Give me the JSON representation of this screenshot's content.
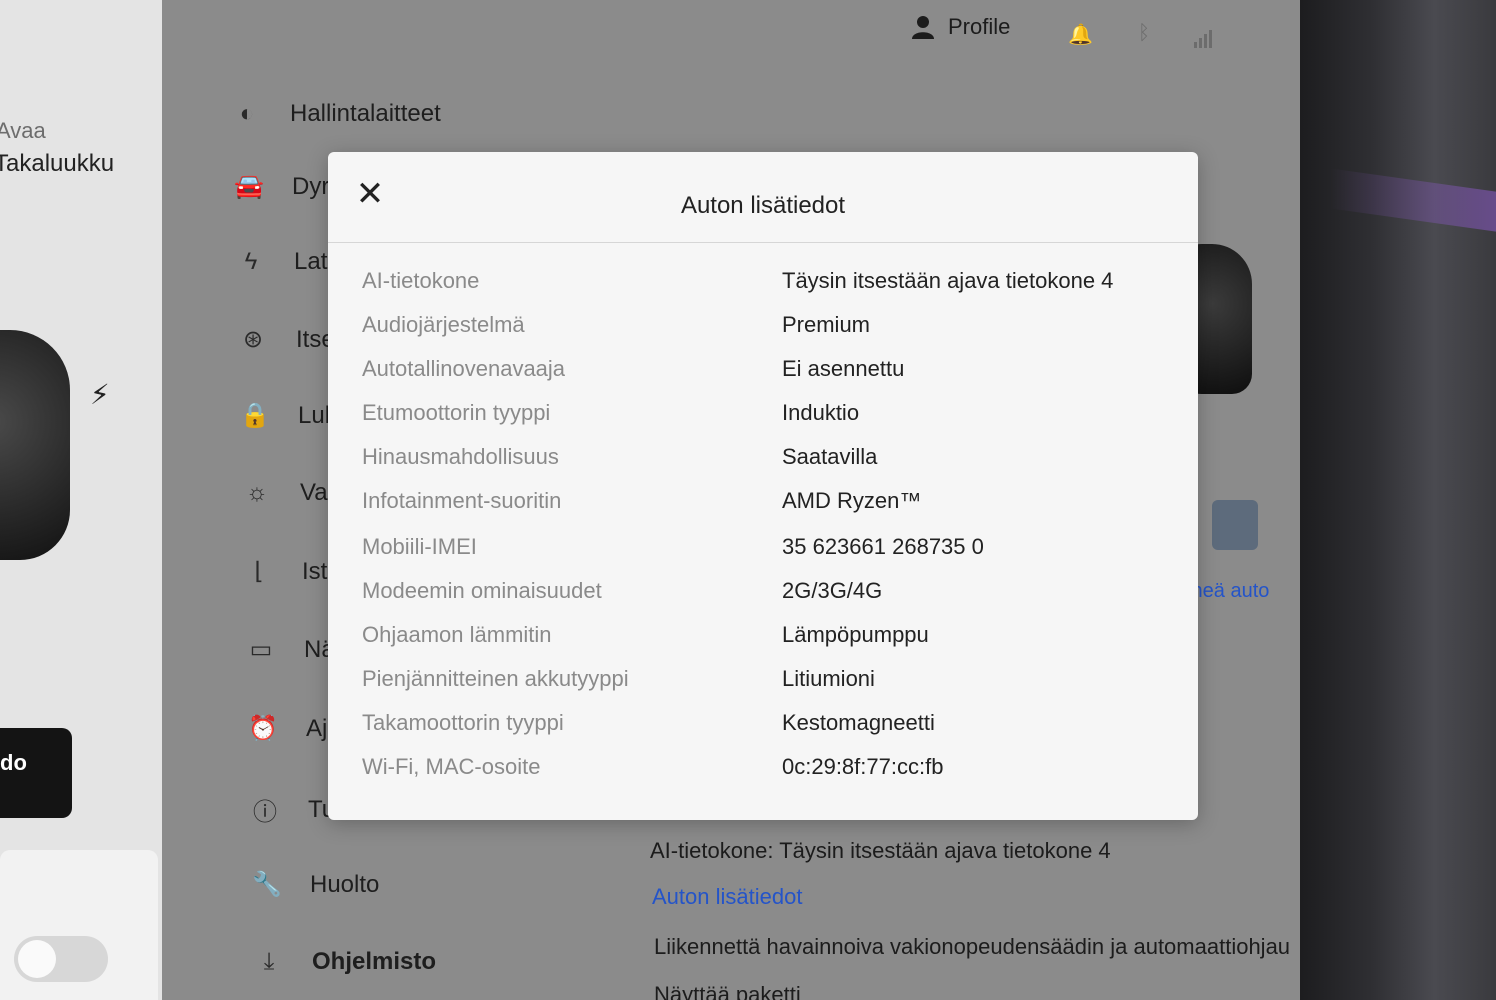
{
  "car_panel": {
    "open_label": "Avaa",
    "trunk_label": "Takaluukku",
    "bolt_icon": "lightning-icon",
    "button_label": "do"
  },
  "topbar": {
    "profile_label": "Profile",
    "icons": [
      "person-icon",
      "bell-icon",
      "bluetooth-icon",
      "lte-signal-icon"
    ]
  },
  "menu": [
    {
      "label": "Hallintalaitteet",
      "icon": "toggle-icon"
    },
    {
      "label": "Dyr",
      "icon": "car-icon"
    },
    {
      "label": "Lat",
      "icon": "lightning-icon"
    },
    {
      "label": "Itse",
      "icon": "steering-wheel-icon"
    },
    {
      "label": "Luk",
      "icon": "lock-icon"
    },
    {
      "label": "Val",
      "icon": "sun-icon"
    },
    {
      "label": "Istu",
      "icon": "seat-icon"
    },
    {
      "label": "Näy",
      "icon": "display-icon"
    },
    {
      "label": "Aja",
      "icon": "alarm-clock-icon"
    },
    {
      "label": "Tur",
      "icon": "warning-icon"
    },
    {
      "label": "Huolto",
      "icon": "wrench-icon"
    },
    {
      "label": "Ohjelmisto",
      "icon": "download-icon",
      "selected": true
    }
  ],
  "content": {
    "ai_computer_line": "AI-tietokone: Täysin itsestään ajava tietokone 4",
    "details_link": "Auton lisätiedot",
    "cruise_line": "Liikennettä havainnoiva vakionopeudensäädin ja automaattiohjau",
    "package_line": "Näyttää paketti",
    "car_link": "meä auto"
  },
  "modal": {
    "title": "Auton lisätiedot",
    "close_icon": "close-icon",
    "rows": [
      {
        "label": "AI-tietokone",
        "value": "Täysin itsestään ajava tietokone 4"
      },
      {
        "label": "Audiojärjestelmä",
        "value": "Premium"
      },
      {
        "label": "Autotallinovenavaaja",
        "value": "Ei asennettu"
      },
      {
        "label": "Etumoottorin tyyppi",
        "value": "Induktio"
      },
      {
        "label": "Hinausmahdollisuus",
        "value": "Saatavilla"
      },
      {
        "label": "Infotainment-suoritin",
        "value": "AMD Ryzen™"
      },
      {
        "label": "Mobiili-IMEI",
        "value": "35 623661 268735 0"
      },
      {
        "label": "Modeemin ominaisuudet",
        "value": "2G/3G/4G"
      },
      {
        "label": "Ohjaamon lämmitin",
        "value": "Lämpöpumppu"
      },
      {
        "label": "Pienjännitteinen akkutyyppi",
        "value": "Litiumioni"
      },
      {
        "label": "Takamoottorin tyyppi",
        "value": "Kestomagneetti"
      },
      {
        "label": "Wi-Fi, MAC-osoite",
        "value": "0c:29:8f:77:cc:fb"
      }
    ]
  }
}
